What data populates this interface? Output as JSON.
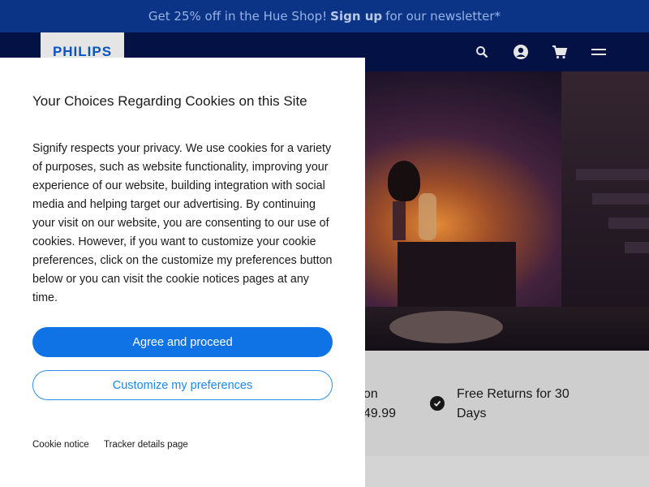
{
  "promo": {
    "text_before": "Get 25% off in the Hue Shop!",
    "link": "Sign up",
    "text_after": "for our newsletter*"
  },
  "header": {
    "logo": "PHILIPS",
    "icons": [
      "search-icon",
      "account-icon",
      "cart-icon",
      "menu-icon"
    ]
  },
  "features": {
    "item1_line1": "on",
    "item1_line2": "49.99",
    "item2_line1": "Free Returns for 30",
    "item2_line2": "Days"
  },
  "cookie_dialog": {
    "title": "Your Choices Regarding Cookies on this Site",
    "body": "Signify respects your privacy. We use cookies for a variety of purposes, such as website functionality, improving your experience of our website, building integration with social media and helping target our advertising. By continuing your visit on our website, you are consenting to our use of cookies. However, if you want to customize your cookie preferences, click on the customize my preferences button below or you can visit the cookie notices pages at any time.",
    "agree_label": "Agree and proceed",
    "customize_label": "Customize my preferences",
    "cookie_notice_link": "Cookie notice",
    "tracker_details_link": "Tracker details page"
  },
  "colors": {
    "promo_bg": "#0e3a96",
    "header_bg": "#04134d",
    "primary_button": "#0f73e6",
    "secondary_border": "#2f8de8"
  }
}
